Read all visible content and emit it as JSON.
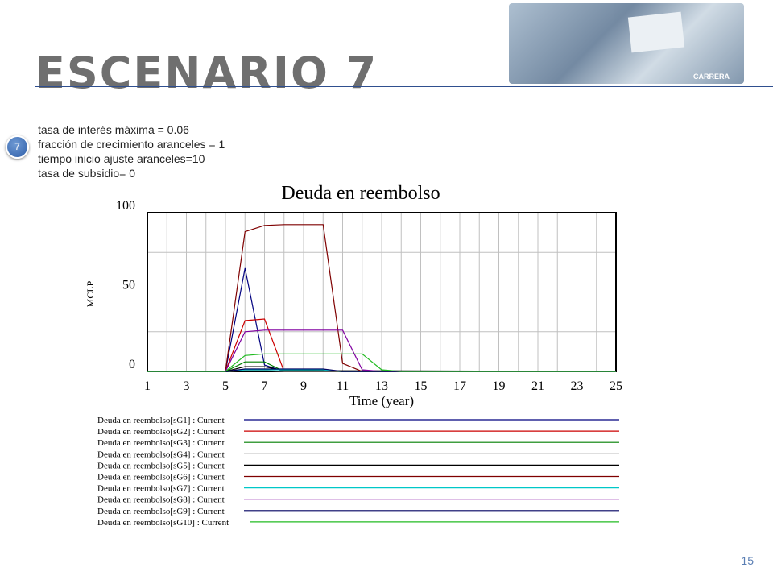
{
  "slide": {
    "title": "ESCENARIO 7",
    "bullet_number": "7",
    "params": [
      "tasa de interés máxima =  0.06",
      "fracción de crecimiento aranceles = 1",
      "tiempo inicio ajuste aranceles=10",
      "tasa de subsidio= 0"
    ],
    "photo_stamp": "CARRERA",
    "page_number": "15"
  },
  "chart_data": {
    "type": "line",
    "title": "Deuda en reembolso",
    "xlabel": "Time (year)",
    "ylabel": "MCLP",
    "xlim": [
      1,
      25
    ],
    "ylim": [
      0,
      100
    ],
    "xticks": [
      1,
      3,
      5,
      7,
      9,
      11,
      13,
      15,
      17,
      19,
      21,
      23,
      25
    ],
    "yticks": [
      0,
      50,
      100
    ],
    "grid": true,
    "legend_position": "below",
    "series": [
      {
        "name": "Deuda en reembolso[sG1] : Current",
        "color": "#00007f",
        "points": [
          [
            1,
            0
          ],
          [
            5,
            0
          ],
          [
            6,
            65
          ],
          [
            7,
            4
          ],
          [
            8,
            0
          ],
          [
            25,
            0
          ]
        ]
      },
      {
        "name": "Deuda en reembolso[sG2] : Current",
        "color": "#cc0000",
        "points": [
          [
            1,
            0
          ],
          [
            5,
            0
          ],
          [
            6,
            32
          ],
          [
            7,
            33
          ],
          [
            8,
            0
          ],
          [
            25,
            0
          ]
        ]
      },
      {
        "name": "Deuda en reembolso[sG3] : Current",
        "color": "#007f00",
        "points": [
          [
            1,
            0
          ],
          [
            5,
            0
          ],
          [
            6,
            6
          ],
          [
            7,
            6
          ],
          [
            8,
            0
          ],
          [
            25,
            0
          ]
        ]
      },
      {
        "name": "Deuda en reembolso[sG4] : Current",
        "color": "#7f7f7f",
        "points": [
          [
            1,
            0
          ],
          [
            5,
            0
          ],
          [
            6,
            0.5
          ],
          [
            7,
            0.5
          ],
          [
            8,
            0
          ],
          [
            25,
            0
          ]
        ]
      },
      {
        "name": "Deuda en reembolso[sG5] : Current",
        "color": "#000000",
        "points": [
          [
            1,
            0
          ],
          [
            5,
            0
          ],
          [
            6,
            3
          ],
          [
            7,
            3
          ],
          [
            8,
            0.5
          ],
          [
            25,
            0
          ]
        ]
      },
      {
        "name": "Deuda en reembolso[sG6] : Current",
        "color": "#7f0000",
        "points": [
          [
            1,
            0
          ],
          [
            5,
            0
          ],
          [
            6,
            88
          ],
          [
            7,
            92
          ],
          [
            8,
            92.5
          ],
          [
            10,
            92.5
          ],
          [
            11,
            5
          ],
          [
            12,
            0
          ],
          [
            25,
            0
          ]
        ]
      },
      {
        "name": "Deuda en reembolso[sG7] : Current",
        "color": "#00c8c8",
        "points": [
          [
            1,
            0
          ],
          [
            5,
            0
          ],
          [
            6,
            1
          ],
          [
            10,
            1
          ],
          [
            11,
            0
          ],
          [
            25,
            0
          ]
        ]
      },
      {
        "name": "Deuda en reembolso[sG8] : Current",
        "color": "#8000a0",
        "points": [
          [
            1,
            0
          ],
          [
            5,
            0
          ],
          [
            6,
            25
          ],
          [
            7,
            26
          ],
          [
            11,
            26
          ],
          [
            12,
            1
          ],
          [
            13,
            0
          ],
          [
            25,
            0
          ]
        ]
      },
      {
        "name": "Deuda en reembolso[sG9] : Current",
        "color": "#000060",
        "points": [
          [
            1,
            0
          ],
          [
            5,
            0
          ],
          [
            6,
            1.5
          ],
          [
            10,
            1.5
          ],
          [
            11,
            0
          ],
          [
            25,
            0
          ]
        ]
      },
      {
        "name": "Deuda en reembolso[sG10] : Current",
        "color": "#22bb22",
        "points": [
          [
            1,
            0
          ],
          [
            5,
            0
          ],
          [
            6,
            10
          ],
          [
            7,
            11
          ],
          [
            12,
            11
          ],
          [
            13,
            1
          ],
          [
            14,
            0
          ],
          [
            25,
            0
          ]
        ]
      }
    ]
  }
}
